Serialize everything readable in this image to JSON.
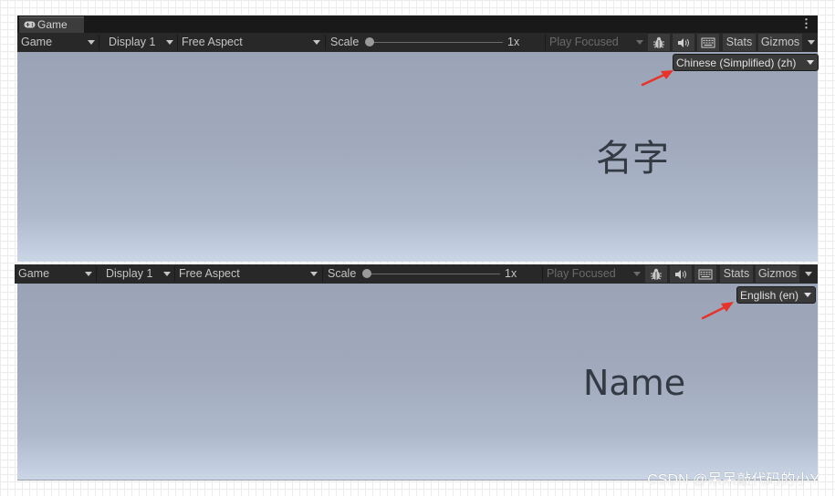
{
  "colors": {
    "accent_arrow": "#e8332a",
    "toolbar_bg": "#282828",
    "tab_bg": "#3c3c3c",
    "view_gradient_top": "#9aa4b6",
    "view_gradient_bottom": "#cad6e6"
  },
  "window_tab": {
    "label": "Game",
    "icon": "gamepad-icon",
    "menu_glyph": "⋮"
  },
  "toolbars": [
    {
      "mode_label": "Game",
      "display_label": "Display 1",
      "aspect_label": "Free Aspect",
      "scale_label": "Scale",
      "scale_value": "1x",
      "scale_level": 0,
      "play_focused_label": "Play Focused",
      "stats_label": "Stats",
      "gizmos_label": "Gizmos"
    },
    {
      "mode_label": "Game",
      "display_label": "Display 1",
      "aspect_label": "Free Aspect",
      "scale_label": "Scale",
      "scale_value": "1x",
      "scale_level": 0,
      "play_focused_label": "Play Focused",
      "stats_label": "Stats",
      "gizmos_label": "Gizmos"
    }
  ],
  "views": [
    {
      "language_selected": "Chinese (Simplified) (zh)",
      "display_text": "名字"
    },
    {
      "language_selected": "English (en)",
      "display_text": "Name"
    }
  ],
  "watermark": "CSDN @呆呆敲代码的小Y"
}
